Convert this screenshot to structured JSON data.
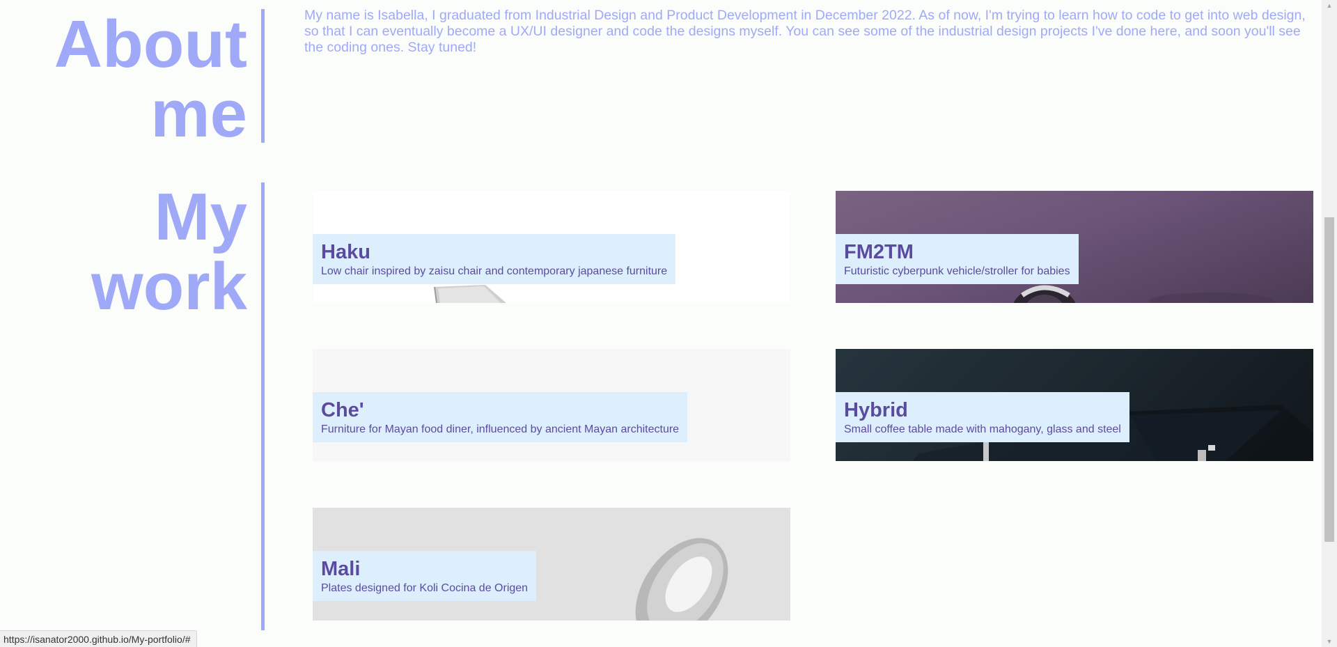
{
  "about": {
    "title_line1": "About",
    "title_line2": "me",
    "text": "My name is Isabella, I graduated from Industrial Design and Product Development in December 2022. As of now, I'm trying to learn how to code to get into web design, so that I can eventually become a UX/UI designer and code the designs myself. You can see some of the industrial design projects I've done here, and soon you'll see the coding ones. Stay tuned!"
  },
  "work": {
    "title_line1": "My",
    "title_line2": "work",
    "projects": [
      {
        "name": "Haku",
        "description": "Low chair inspired by zaisu chair and contemporary japanese furniture"
      },
      {
        "name": "FM2TM",
        "description": "Futuristic cyberpunk vehicle/stroller for babies"
      },
      {
        "name": "Che'",
        "description": "Furniture for Mayan food diner, influenced by ancient Mayan architecture"
      },
      {
        "name": "Hybrid",
        "description": "Small coffee table made with mahogany, glass and steel"
      },
      {
        "name": "Mali",
        "description": "Plates designed for Koli Cocina de Origen"
      }
    ]
  },
  "status_bar": {
    "url": "https://isanator2000.github.io/My-portfolio/#"
  },
  "colors": {
    "accent": "#a0a9f8",
    "label_bg": "#ddeffd",
    "label_text": "#5b4b9f",
    "page_bg": "#fbfdfa"
  }
}
